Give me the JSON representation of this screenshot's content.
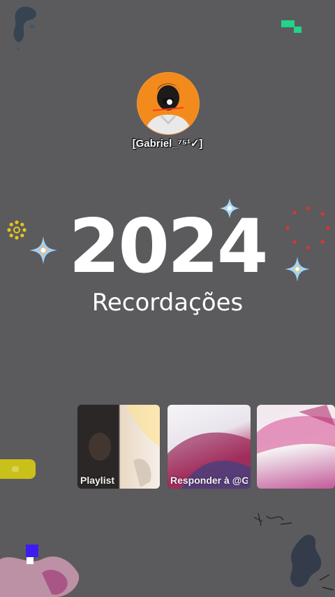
{
  "profile": {
    "username": "[Gabriel_⁷⁵¹✓]",
    "avatar_icon": "profile-avatar"
  },
  "headline": {
    "year": "2024",
    "subtitle": "Recordações"
  },
  "cards": [
    {
      "label": "Playlist"
    },
    {
      "label": "Responder à @Gabriel De..."
    },
    {
      "label": ""
    }
  ],
  "colors": {
    "background": "#5b5b5d",
    "accent_green": "#22d38a",
    "avatar_orange": "#f38a1c",
    "accent_blue": "#3d1cf3",
    "sparkle_blue": "#9fd3ff",
    "sparkle_gold": "#f5d061",
    "dots_red": "#e0322f",
    "sun_yellow": "#e9c51b"
  },
  "icons": [
    "sparkle-icon",
    "sun-icon",
    "red-dot-ring-icon"
  ]
}
